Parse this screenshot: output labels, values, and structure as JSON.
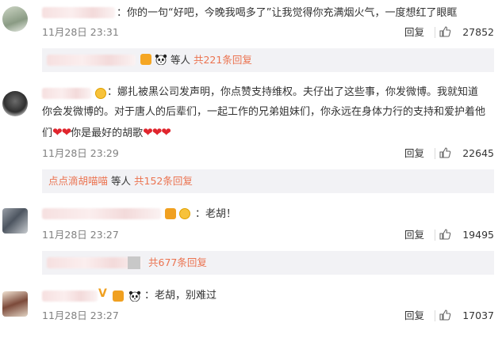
{
  "comments": [
    {
      "text": "：你的一句“好吧，今晚我喝多了”让我觉得你充满烟火气，一度想红了眼眶",
      "time": "11月28日 23:31",
      "reply_label": "回复",
      "likes": "27852",
      "sub": {
        "suffix": "等人",
        "count_label": "共221条回复"
      }
    },
    {
      "text_line1": "：娜扎被黑公司发声明，你点赞支持维权。夫仔出了这些事，你发微博。我就知道",
      "text_line2": "你会发微博的。对于唐人的后辈们，一起工作的兄弟姐妹们，你永远在身体力行的支持和爱护着他",
      "text_line3_pre": "们",
      "text_line3_mid": "你是最好的胡歌",
      "time": "11月28日 23:29",
      "reply_label": "回复",
      "likes": "22645",
      "sub": {
        "who": "点点滴胡喵喵",
        "suffix": "等人",
        "count_label": "共152条回复"
      }
    },
    {
      "text": "：老胡！",
      "time": "11月28日 23:27",
      "reply_label": "回复",
      "likes": "19495",
      "sub": {
        "count_label": "共677条回复"
      }
    },
    {
      "text": "：老胡，别难过",
      "time": "11月28日 23:27",
      "reply_label": "回复",
      "likes": "17037"
    }
  ],
  "colors": {
    "accent": "#eb7350",
    "heart": "#e0252d",
    "muted": "#808080"
  },
  "icons": [
    "thumbs-up-icon",
    "panda-emoji-icon",
    "heart-emoji-icon",
    "vip-badge-icon",
    "fan-badge-icon"
  ]
}
